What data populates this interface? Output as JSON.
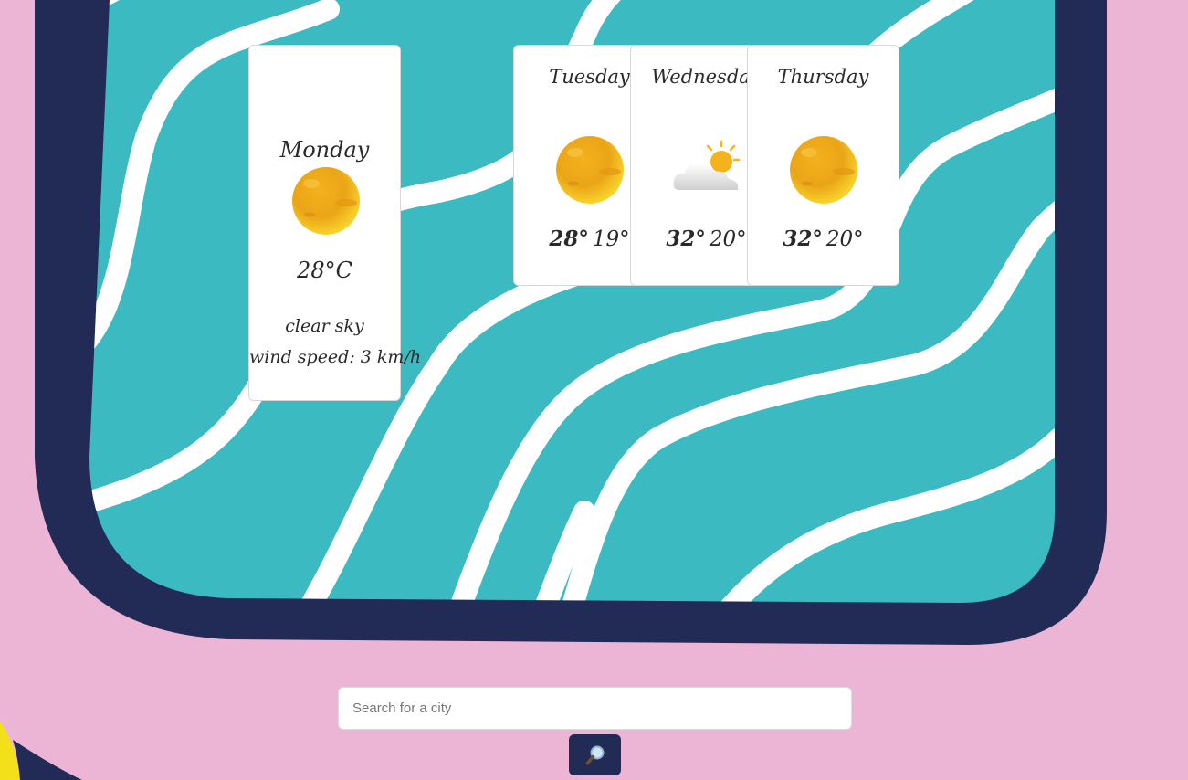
{
  "today": {
    "day": "Monday",
    "icon": "sun-icon",
    "temperature": "28°C",
    "description": "clear sky",
    "wind": "wind speed: 3 km/h"
  },
  "forecast": [
    {
      "day": "Tuesday",
      "icon": "sun-icon",
      "max": "28°",
      "min": "19°"
    },
    {
      "day": "Wednesday",
      "icon": "partly-cloudy-icon",
      "max": "32°",
      "min": "20°"
    },
    {
      "day": "Thursday",
      "icon": "sun-icon",
      "max": "32°",
      "min": "20°"
    }
  ],
  "search": {
    "placeholder": "Search for a city"
  },
  "search_button": {
    "icon": "search-icon"
  },
  "colors": {
    "page_background": "#ecb5d6",
    "frame": "#222a56",
    "water": "#3cbac2",
    "wave": "#ffffff",
    "accent_yellow": "#f4e01a",
    "sun": "#f0b21a"
  }
}
